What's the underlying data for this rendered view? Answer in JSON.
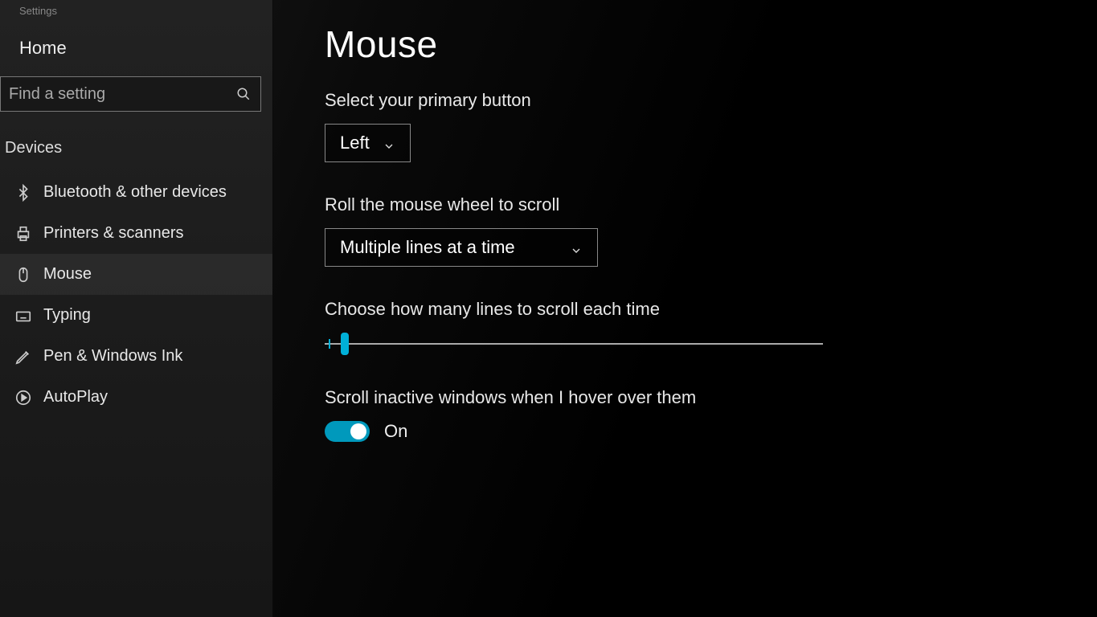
{
  "app_title": "Settings",
  "sidebar": {
    "home_label": "Home",
    "search_placeholder": "Find a setting",
    "category": "Devices",
    "items": [
      {
        "label": "Bluetooth & other devices",
        "icon": "bluetooth-icon",
        "active": false
      },
      {
        "label": "Printers & scanners",
        "icon": "printer-icon",
        "active": false
      },
      {
        "label": "Mouse",
        "icon": "mouse-icon",
        "active": true
      },
      {
        "label": "Typing",
        "icon": "keyboard-icon",
        "active": false
      },
      {
        "label": "Pen & Windows Ink",
        "icon": "pen-icon",
        "active": false
      },
      {
        "label": "AutoPlay",
        "icon": "autoplay-icon",
        "active": false
      }
    ]
  },
  "main": {
    "title": "Mouse",
    "primary_button": {
      "label": "Select your primary button",
      "value": "Left"
    },
    "wheel_scroll": {
      "label": "Roll the mouse wheel to scroll",
      "value": "Multiple lines at a time"
    },
    "lines_slider": {
      "label": "Choose how many lines to scroll each time",
      "position_percent": 4
    },
    "inactive_scroll": {
      "label": "Scroll inactive windows when I hover over them",
      "state_label": "On",
      "on": true
    }
  },
  "colors": {
    "accent": "#0099bc"
  }
}
